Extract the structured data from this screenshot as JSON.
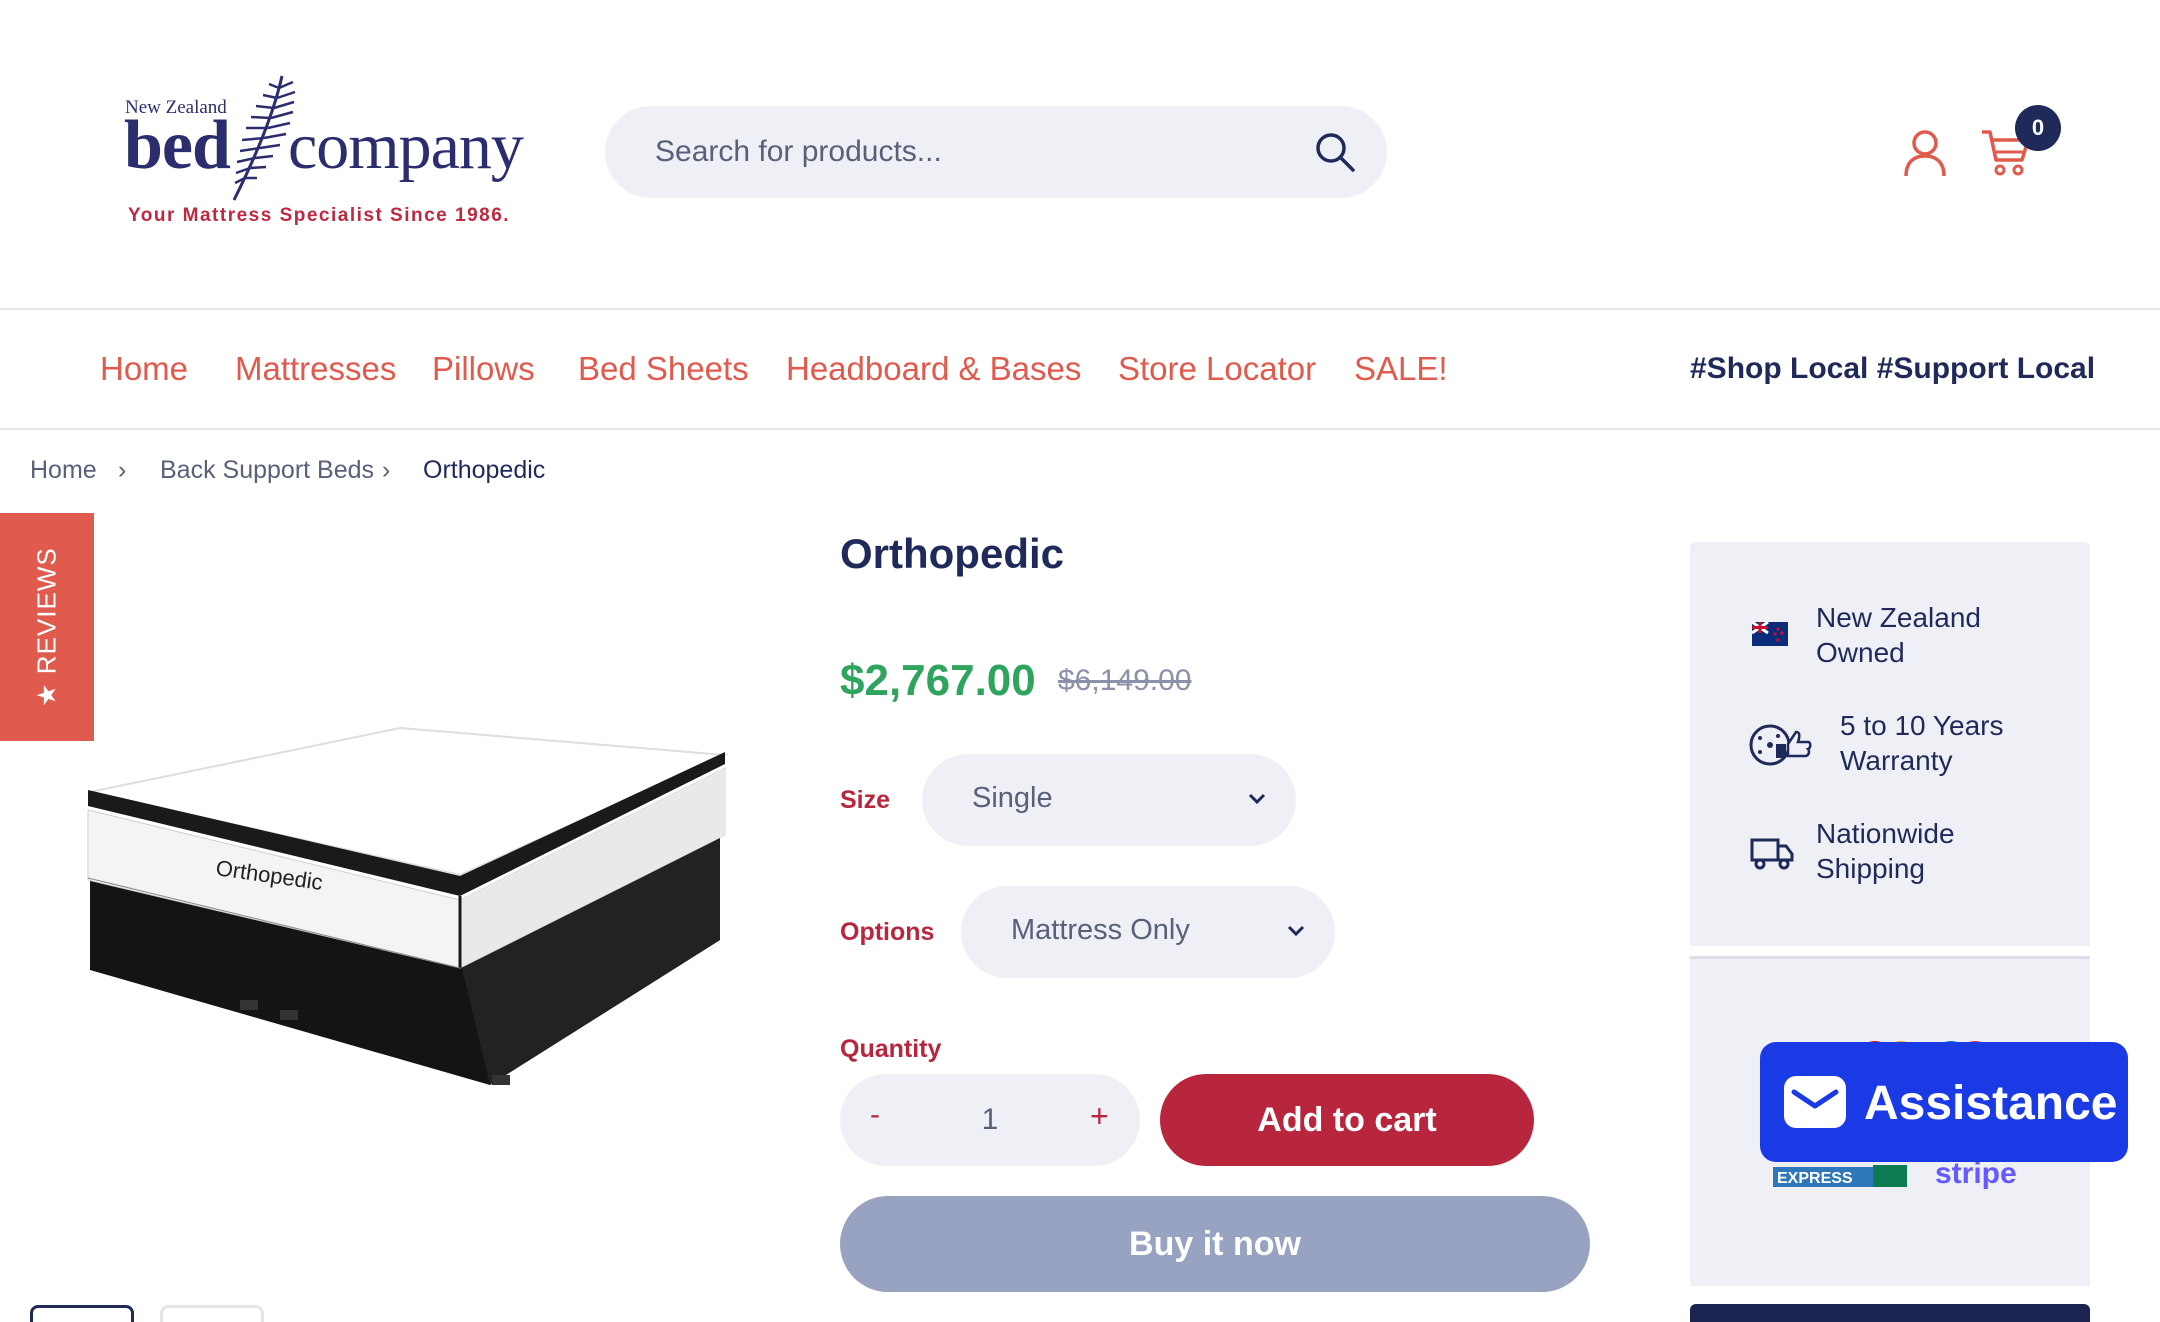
{
  "brand": {
    "logo_small": "New Zealand",
    "logo_word1": "bed",
    "logo_word2": "company",
    "tagline": "Your Mattress Specialist Since 1986."
  },
  "search": {
    "placeholder": "Search for products..."
  },
  "header": {
    "cart_count": "0"
  },
  "nav": {
    "items": [
      "Home",
      "Mattresses",
      "Pillows",
      "Bed Sheets",
      "Headboard & Bases",
      "Store Locator",
      "SALE!"
    ],
    "slogan": "#Shop Local #Support Local"
  },
  "breadcrumb": {
    "items": [
      "Home",
      "Back Support Beds",
      "Orthopedic"
    ],
    "separator": "›"
  },
  "reviews_tab": {
    "label": "★ REVIEWS"
  },
  "product": {
    "title": "Orthopedic",
    "price": "$2,767.00",
    "compare_price": "$6,149.00",
    "image_label": "Orthopedic",
    "size_label": "Size",
    "size_value": "Single",
    "options_label": "Options",
    "options_value": "Mattress Only",
    "quantity_label": "Quantity",
    "quantity_value": "1",
    "minus": "-",
    "plus": "+",
    "add_to_cart": "Add to cart",
    "buy_now": "Buy it now"
  },
  "features": [
    {
      "icon": "nz-flag-icon",
      "text": "New Zealand Owned"
    },
    {
      "icon": "warranty-icon",
      "text": "5 to 10 Years Warranty"
    },
    {
      "icon": "truck-icon",
      "text": "Nationwide Shipping"
    }
  ],
  "payment": {
    "partial_text1": "EXPRESS",
    "partial_text2": "stripe"
  },
  "assistance": {
    "label": "Assistance"
  },
  "colors": {
    "navy": "#1f2a5a",
    "coral": "#e05a4d",
    "crimson": "#b8263e",
    "green": "#2fa45e",
    "assist_blue": "#1a3ae6"
  }
}
